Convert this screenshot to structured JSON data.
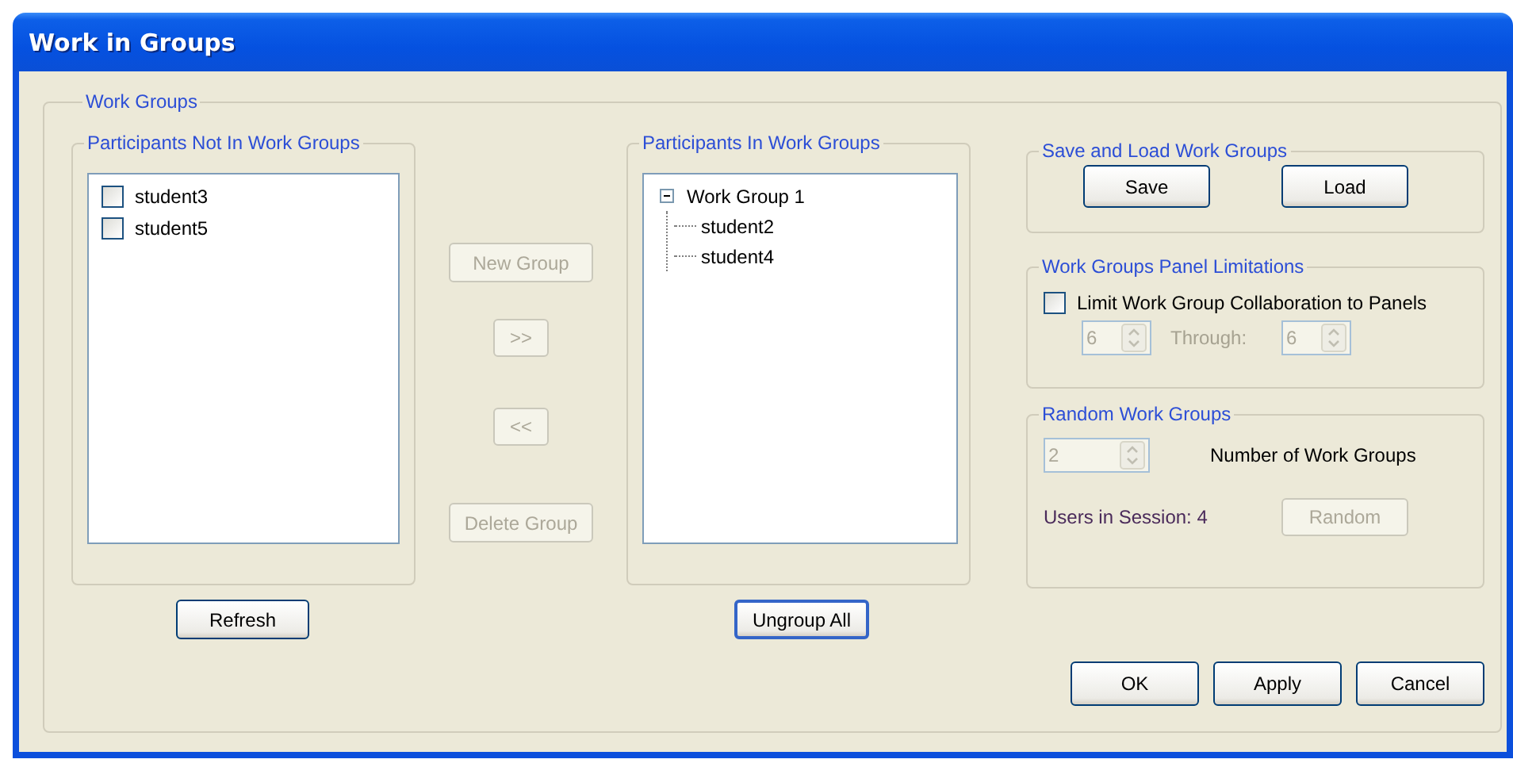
{
  "window": {
    "title": "Work in Groups"
  },
  "work_groups": {
    "title": "Work Groups",
    "not_in_groups": {
      "title": "Participants Not In Work Groups",
      "items": [
        {
          "label": "student3",
          "checked": false
        },
        {
          "label": "student5",
          "checked": false
        }
      ],
      "refresh_button": "Refresh"
    },
    "middle_buttons": [
      {
        "label": "New Group",
        "disabled": true,
        "kind": "wide"
      },
      {
        "label": ">>",
        "disabled": true,
        "kind": "narrow"
      },
      {
        "label": "<<",
        "disabled": true,
        "kind": "narrow"
      },
      {
        "label": "Delete Group",
        "disabled": true,
        "kind": "wide"
      }
    ],
    "in_groups": {
      "title": "Participants In Work Groups",
      "tree": [
        {
          "label": "Work Group 1",
          "expanded": true,
          "children": [
            {
              "label": "student2"
            },
            {
              "label": "student4"
            }
          ]
        }
      ],
      "ungroup_button": "Ungroup All"
    },
    "save_load": {
      "title": "Save and Load Work Groups",
      "buttons": [
        {
          "label": "Save",
          "disabled": false
        },
        {
          "label": "Load",
          "disabled": false
        }
      ]
    },
    "panel_limitations": {
      "title": "Work Groups Panel Limitations",
      "checkbox": {
        "label": "Limit Work Group Collaboration to Panels",
        "checked": false
      },
      "from": {
        "value": "6",
        "disabled": true
      },
      "through_label": "Through:",
      "to": {
        "value": "6",
        "disabled": true
      }
    },
    "random": {
      "title": "Random Work Groups",
      "count": {
        "value": "2",
        "disabled": true
      },
      "count_label": "Number of Work Groups",
      "users_label": "Users in Session: 4",
      "button": {
        "label": "Random",
        "disabled": true
      }
    }
  },
  "buttons": [
    {
      "label": "OK"
    },
    {
      "label": "Apply"
    },
    {
      "label": "Cancel"
    }
  ]
}
